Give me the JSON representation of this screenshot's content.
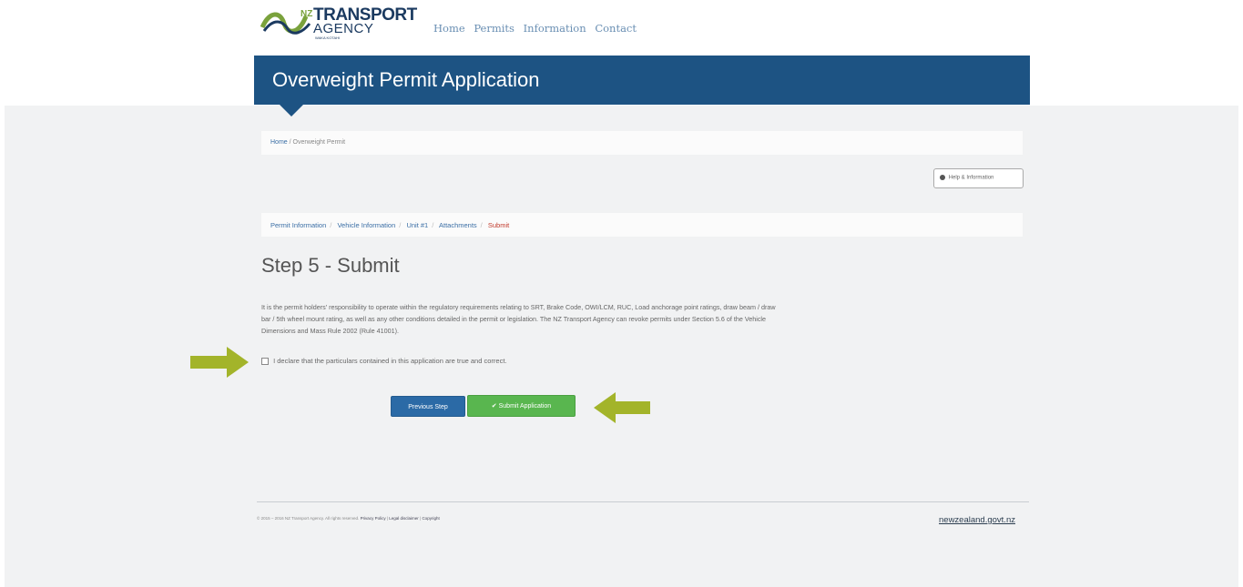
{
  "colors": {
    "brand_blue": "#1d5383",
    "submit_green": "#59b64f",
    "arrow_green": "#a3b42a",
    "active_step": "#c0392b"
  },
  "logo": {
    "nz": "NZ",
    "line1": "TRANSPORT",
    "line2": "AGENCY",
    "line3": "WAKA KOTAHI"
  },
  "nav": {
    "items": [
      "Home",
      "Permits",
      "Information",
      "Contact"
    ]
  },
  "banner": {
    "title": "Overweight Permit Application"
  },
  "breadcrumb": {
    "home": "Home",
    "current": "Overweight Permit"
  },
  "help_button": {
    "label": "Help & Information",
    "icon": "info-circle-icon"
  },
  "steps": {
    "items": [
      "Permit Information",
      "Vehicle Information",
      "Unit #1",
      "Attachments",
      "Submit"
    ],
    "active_index": 4
  },
  "step_title": "Step 5 - Submit",
  "disclaimer": {
    "line1": "It is the permit holders' responsibility to operate within the regulatory requirements relating to SRT, Brake Code, OWI/LCM, RUC, Load anchorage point ratings, draw beam / draw",
    "line2": "bar / 5th wheel mount rating, as well as any other conditions detailed in the permit or legislation. The NZ Transport Agency can revoke permits under Section 5.6 of the Vehicle",
    "line3": "Dimensions and Mass Rule 2002 (Rule 41001)."
  },
  "declaration": {
    "label": "I declare that the particulars contained in this application are true and correct.",
    "checked": false
  },
  "buttons": {
    "previous": "Previous Step",
    "submit": "Submit Application"
  },
  "footer": {
    "copyright": "© 2015 – 2016 NZ Transport Agency. All rights reserved.",
    "privacy": "Privacy Policy",
    "legal": "Legal disclaimer",
    "copy_link": "Copyright",
    "govt": "newzealand.govt.nz"
  }
}
